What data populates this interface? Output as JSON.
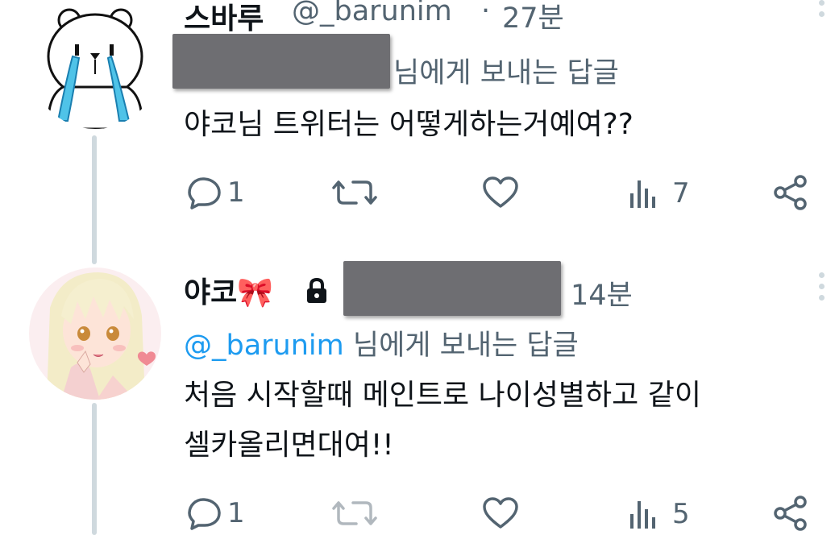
{
  "tweets": [
    {
      "name": "스바루",
      "handle": "@_barunim",
      "separator": "·",
      "time": "27분",
      "reply_to_suffix": "님에게 보내는 답글",
      "text": "야코님 트위터는 어떻게하는거예여??",
      "actions": {
        "reply_count": "1",
        "retweet_count": "",
        "like_count": "",
        "views_count": "7"
      }
    },
    {
      "name": "야코🎀",
      "time": "14분",
      "reply_to_mention": "@_barunim",
      "reply_to_suffix": "님에게 보내는 답글",
      "text_lines": [
        "처음 시작할때 메인트로 나이성별하고 같이",
        "셀카올리면대여!!"
      ],
      "actions": {
        "reply_count": "1",
        "retweet_count": "",
        "like_count": "",
        "views_count": "5"
      }
    }
  ],
  "icons": [
    "reply-icon",
    "retweet-icon",
    "like-icon",
    "views-icon",
    "share-icon",
    "lock-icon",
    "more-icon"
  ],
  "colors": {
    "text": "#0f1419",
    "secondary": "#536471",
    "mention": "#1d9bf0",
    "thread_line": "#cfd9de",
    "redaction": "#6e6e72"
  }
}
